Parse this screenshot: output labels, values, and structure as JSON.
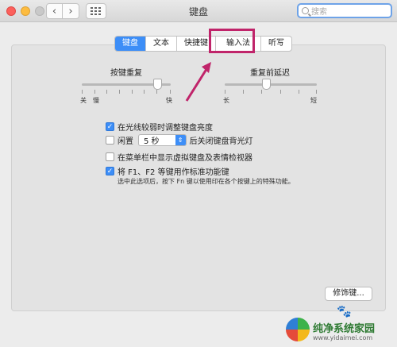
{
  "window": {
    "title": "键盘",
    "search_placeholder": "搜索"
  },
  "tabs": [
    {
      "label": "键盘",
      "active": true
    },
    {
      "label": "文本",
      "active": false
    },
    {
      "label": "快捷键",
      "active": false
    },
    {
      "label": "输入法",
      "active": false
    },
    {
      "label": "听写",
      "active": false
    }
  ],
  "key_repeat": {
    "label": "按键重复",
    "left": "关",
    "left2": "慢",
    "right": "快",
    "value": 0.85
  },
  "delay_until_repeat": {
    "label": "重复前延迟",
    "left": "长",
    "right": "短",
    "value": 0.45
  },
  "options": {
    "adjust_brightness": {
      "label": "在光线较弱时调整键盘亮度",
      "checked": true
    },
    "backlight_off": {
      "prefix": "闲置",
      "selected": "5 秒",
      "suffix": "后关闭键盘背光灯",
      "checked": false
    },
    "show_viewers": {
      "label": "在菜单栏中显示虚拟键盘及表情检视器",
      "checked": false
    },
    "fn_keys": {
      "label": "将 F1、F2 等键用作标准功能键",
      "checked": true,
      "note": "选中此选项后，按下 Fn 键以使用印在各个按键上的特殊功能。"
    }
  },
  "buttons": {
    "modifier_keys": "修饰键..."
  },
  "watermark": {
    "name": "纯净系统家园",
    "url": "www.yidaimei.com"
  },
  "colors": {
    "accent": "#3d8ef7",
    "annotation": "#c0246a"
  }
}
